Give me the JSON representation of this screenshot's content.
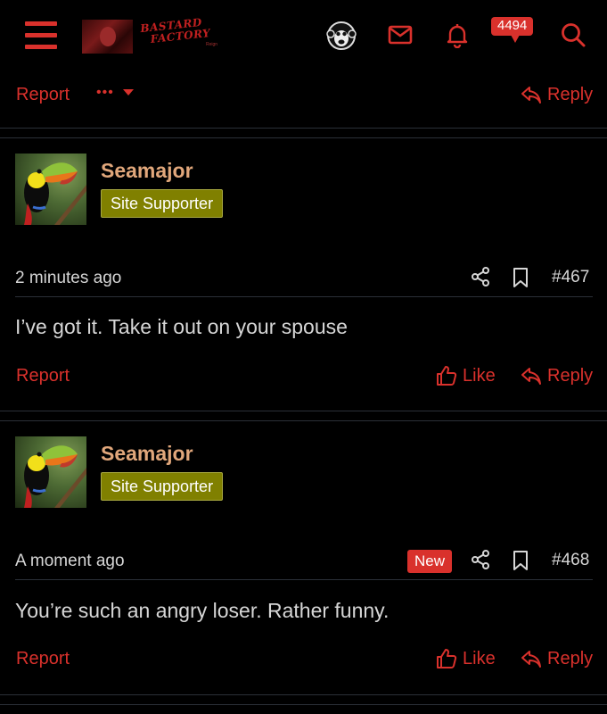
{
  "header": {
    "logo_line1": "BASTARD",
    "logo_line2": "FACTORY",
    "logo_sub": "Reign",
    "notification_count": "4494",
    "icons": [
      "menu-icon",
      "monkey-avatar-icon",
      "envelope-icon",
      "bell-icon",
      "chat-icon",
      "search-icon"
    ]
  },
  "prev_post": {
    "report_label": "Report",
    "more_label": "•••",
    "reply_label": "Reply"
  },
  "posts": [
    {
      "username": "Seamajor",
      "role": "Site Supporter",
      "time": "2 minutes ago",
      "new_label": "",
      "number": "#467",
      "body": "I’ve got it. Take it out on your spouse",
      "report_label": "Report",
      "like_label": "Like",
      "reply_label": "Reply"
    },
    {
      "username": "Seamajor",
      "role": "Site Supporter",
      "time": "A moment ago",
      "new_label": "New",
      "number": "#468",
      "body": "You’re such an angry loser. Rather funny.",
      "report_label": "Report",
      "like_label": "Like",
      "reply_label": "Reply"
    }
  ],
  "colors": {
    "accent": "#d9312c",
    "username": "#e1a77b",
    "role_bg": "#808000",
    "background": "#000000",
    "divider": "#2b3038"
  }
}
